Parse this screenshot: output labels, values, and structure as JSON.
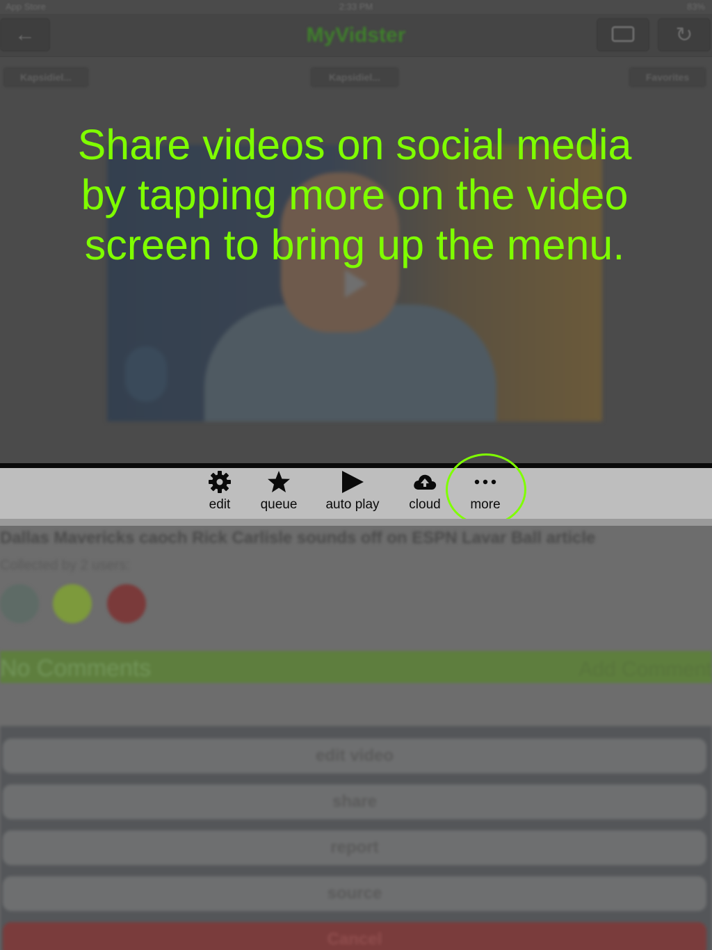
{
  "status_bar": {
    "left": "App Store",
    "time": "2:33 PM",
    "battery": "83%"
  },
  "nav": {
    "back_icon": "arrow-left-icon",
    "title": "MyVidster",
    "cast_icon": "cast-icon",
    "refresh_icon": "refresh-icon"
  },
  "tabs": [
    "Kapsidiel...",
    "Kapsidiel...",
    "Favorites"
  ],
  "caption": "Share videos on social media by tapping more on the video screen to bring up the menu.",
  "toolbar": {
    "items": [
      {
        "label": "edit",
        "icon": "gear-icon"
      },
      {
        "label": "queue",
        "icon": "star-icon"
      },
      {
        "label": "auto play",
        "icon": "play-icon"
      },
      {
        "label": "cloud",
        "icon": "cloud-upload-icon"
      },
      {
        "label": "more",
        "icon": "more-dots-icon"
      }
    ]
  },
  "video_info": {
    "title": "Dallas Mavericks caoch Rick Carlisle sounds off on ESPN Lavar Ball article",
    "collected_by": "Collected by 2 users:"
  },
  "comments": {
    "count_label": "No Comments",
    "add_label": "Add Comment"
  },
  "action_sheet": {
    "buttons": [
      "edit video",
      "share",
      "report",
      "source"
    ],
    "cancel": "Cancel"
  },
  "colors": {
    "highlight": "#7fff00",
    "caption": "#7fff00",
    "cancel": "#7a3c3c"
  }
}
